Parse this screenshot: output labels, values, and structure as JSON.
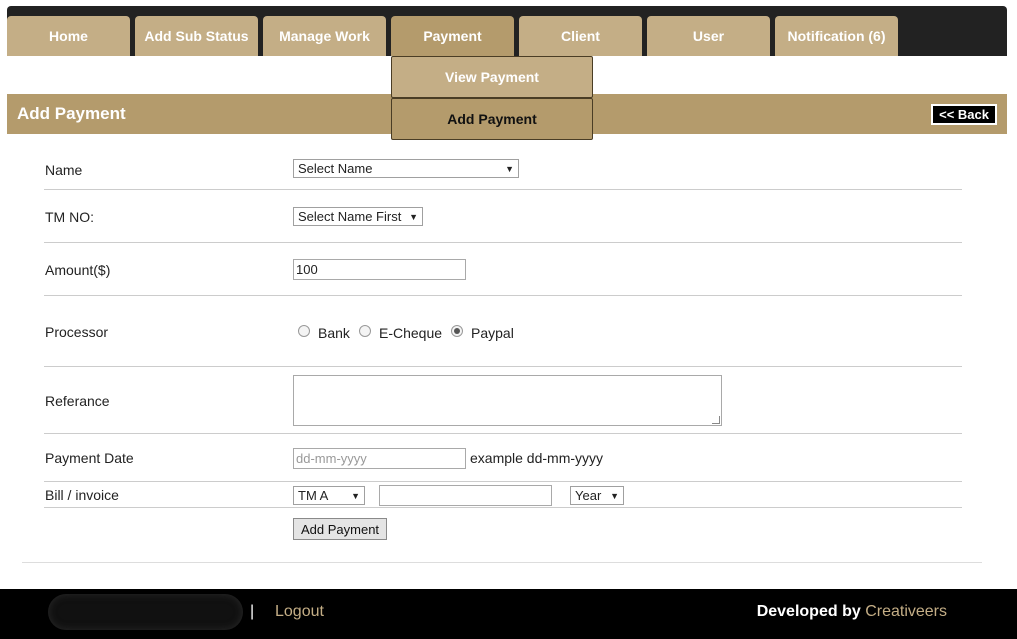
{
  "nav": {
    "tabs": [
      {
        "label": "Home"
      },
      {
        "label": "Add Sub Status"
      },
      {
        "label": "Manage Work"
      },
      {
        "label": "Payment"
      },
      {
        "label": "Client"
      },
      {
        "label": "User"
      },
      {
        "label": "Notification (6)"
      }
    ],
    "active_tab": "Payment",
    "submenu": {
      "view_payment": "View Payment",
      "add_payment": "Add Payment"
    }
  },
  "header": {
    "title": "Add Payment",
    "back_label": "<< Back"
  },
  "form": {
    "name": {
      "label": "Name",
      "selected": "Select Name"
    },
    "tm_no": {
      "label": "TM NO:",
      "selected": "Select Name First"
    },
    "amount": {
      "label": "Amount($)",
      "value": "100"
    },
    "processor": {
      "label": "Processor",
      "options": [
        "Bank",
        "E-Cheque",
        "Paypal"
      ],
      "selected": "Paypal"
    },
    "reference": {
      "label": "Referance",
      "value": ""
    },
    "payment_date": {
      "label": "Payment Date",
      "placeholder": "dd-mm-yyyy",
      "hint": "example dd-mm-yyyy"
    },
    "bill_invoice": {
      "label": "Bill / invoice",
      "tm_selected": "TM A",
      "number_value": "",
      "year_selected": "Year"
    },
    "submit_label": "Add Payment"
  },
  "footer": {
    "separator": "|",
    "logout_label": "Logout",
    "developed_by": "Developed by",
    "brand": "Creativeers"
  },
  "colors": {
    "tab": "#c4ae86",
    "tab_active": "#b49b6c",
    "header_bar": "#b49b6c",
    "topbar": "#222222",
    "footer": "#000000"
  }
}
